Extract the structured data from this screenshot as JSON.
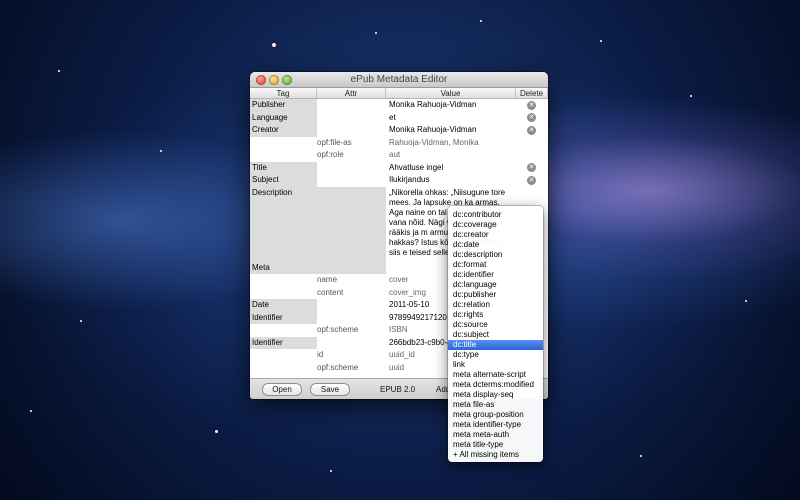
{
  "window": {
    "title": "ePub Metadata Editor"
  },
  "columns": {
    "tag": "Tag",
    "attr": "Attr",
    "value": "Value",
    "delete": "Delete"
  },
  "rows": [
    {
      "tag": "Publisher",
      "value": "Monika Rahuoja-Vidman"
    },
    {
      "tag": "Language",
      "value": "et"
    },
    {
      "tag": "Creator",
      "value": "Monika Rahuoja-Vidman"
    },
    {
      "attr": "opf:file-as",
      "value": "Rahuoja-Vidman, Monika"
    },
    {
      "attr": "opf:role",
      "value": "aut"
    },
    {
      "tag": "Title",
      "value": "Ahvatluse ingel"
    },
    {
      "tag": "Subject",
      "value": "Ilukirjandus"
    },
    {
      "tag": "Description",
      "value": "„Nikorella ohkas: „Niisugune tore mees. Ja lapsuke on ka armas. Aga naine on tal kindlasti mingi vana nõid. Nägi vist akn minuga rääkis ja m armukadedaks. Ja hakkas? Istus köög No ja teinud siis e teised sellepärast"
    },
    {
      "tag": "Meta",
      "value": ""
    },
    {
      "attr": "name",
      "value": "cover"
    },
    {
      "attr": "content",
      "value": "cover_img"
    },
    {
      "tag": "Date",
      "value": "2011-05-10"
    },
    {
      "tag": "Identifier",
      "value": "9789949217120"
    },
    {
      "attr": "opf:scheme",
      "value": "ISBN"
    },
    {
      "tag": "Identifier",
      "value": "266bdb23-c9b0-4"
    },
    {
      "attr": "id",
      "value": "uuid_id"
    },
    {
      "attr": "opf:scheme",
      "value": "uuid"
    }
  ],
  "bottom": {
    "open": "Open",
    "save": "Save",
    "version": "EPUB 2.0",
    "add": "Add"
  },
  "menu": {
    "selected": "dc:title",
    "items": [
      "dc:contributor",
      "dc:coverage",
      "dc:creator",
      "dc:date",
      "dc:description",
      "dc:format",
      "dc:identifier",
      "dc:language",
      "dc:publisher",
      "dc:relation",
      "dc:rights",
      "dc:source",
      "dc:subject",
      "dc:title",
      "dc:type",
      "link",
      "meta alternate-script",
      "meta dcterms:modified",
      "meta display-seq",
      "meta file-as",
      "meta group-position",
      "meta identifier-type",
      "meta meta-auth",
      "meta title-type",
      "+ All missing items"
    ]
  }
}
